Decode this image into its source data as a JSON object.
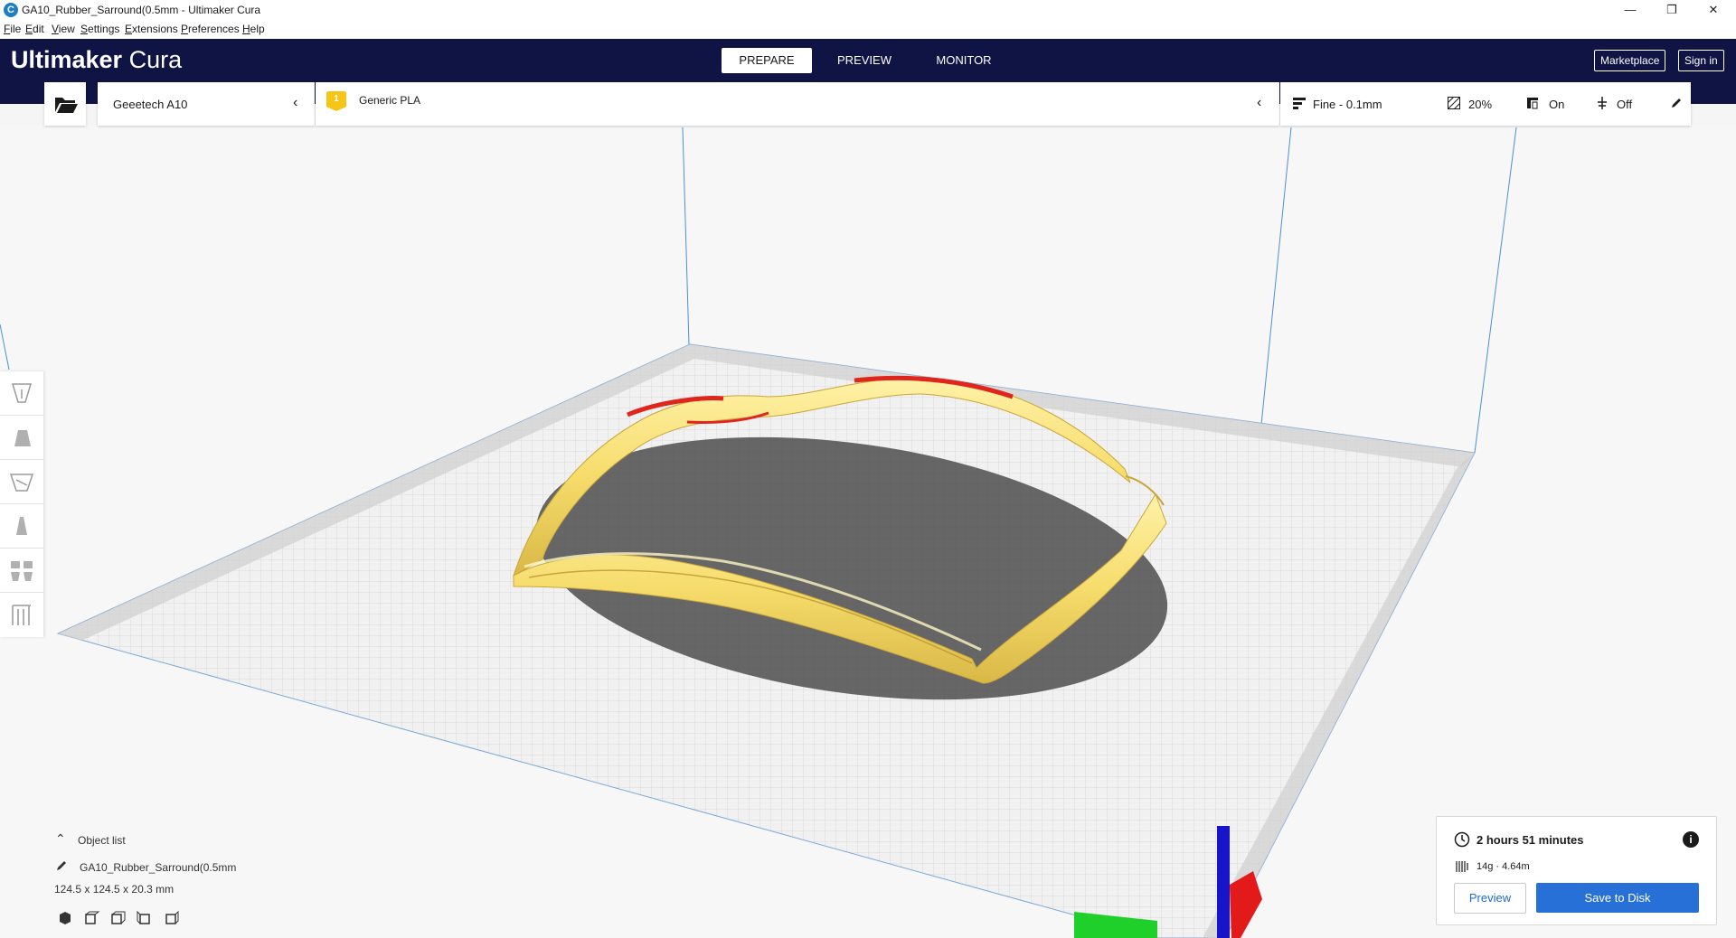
{
  "window": {
    "title": "GA10_Rubber_Sarround(0.5mm - Ultimaker Cura",
    "app_icon": "cura-app-icon"
  },
  "menu": [
    "File",
    "Edit",
    "View",
    "Settings",
    "Extensions",
    "Preferences",
    "Help"
  ],
  "header": {
    "logo_bold": "Ultimaker",
    "logo_light": " Cura",
    "tabs": [
      "PREPARE",
      "PREVIEW",
      "MONITOR"
    ],
    "active_tab": "PREPARE",
    "marketplace": "Marketplace",
    "sign_in": "Sign in"
  },
  "toolbar": {
    "printer": "Geeetech A10",
    "extruder_index": "1",
    "material": "Generic PLA",
    "profile": "Fine - 0.1mm",
    "infill": "20%",
    "support": "On",
    "adhesion": "Off"
  },
  "object_list": {
    "label": "Object list",
    "name": "GA10_Rubber_Sarround(0.5mm",
    "dimensions": "124.5 x 124.5 x 20.3 mm"
  },
  "print_info": {
    "time": "2 hours 51 minutes",
    "material_usage": "14g · 4.64m",
    "preview_label": "Preview",
    "save_label": "Save to Disk"
  },
  "colors": {
    "header_bg": "#0f1445",
    "accent": "#2670d8",
    "model": "#f6dc6b",
    "overhang": "#e0251c",
    "extruder_badge": "#f5c518"
  }
}
